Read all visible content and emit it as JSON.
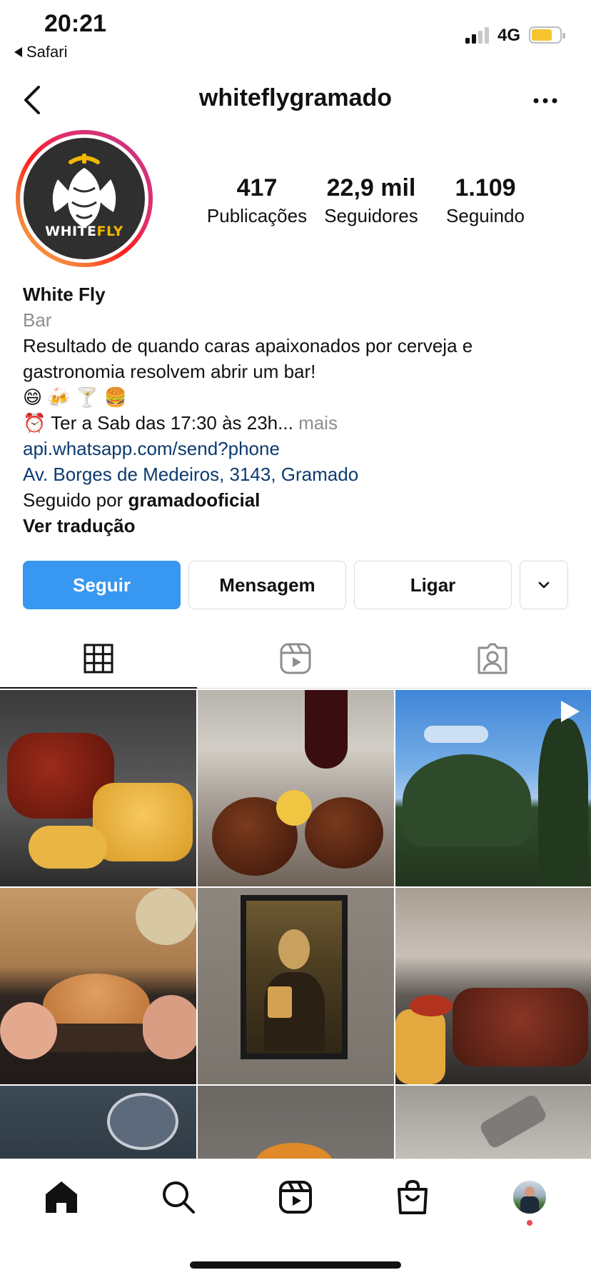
{
  "status_bar": {
    "time": "20:21",
    "back_app": "Safari",
    "network": "4G"
  },
  "header": {
    "username": "whiteflygramado"
  },
  "profile": {
    "avatar_logo_text_a": "WHITE",
    "avatar_logo_text_b": "FLY",
    "stats": [
      {
        "value": "417",
        "label": "Publicações"
      },
      {
        "value": "22,9 mil",
        "label": "Seguidores"
      },
      {
        "value": "1.109",
        "label": "Seguindo"
      }
    ]
  },
  "bio": {
    "name": "White Fly",
    "category": "Bar",
    "description": "Resultado de quando caras apaixonados por cerveja e gastronomia resolvem abrir um bar!",
    "emojis": "😄 🍻 🍸 🍔",
    "hours_emoji": "⏰",
    "hours": "Ter a Sab das 17:30 às 23h...",
    "more_label": "mais",
    "link": "api.whatsapp.com/send?phone",
    "address": "Av. Borges de Medeiros, 3143, Gramado",
    "followed_by_prefix": "Seguido por",
    "followed_by_user": "gramadooficial",
    "translate_label": "Ver tradução"
  },
  "actions": {
    "follow": "Seguir",
    "message": "Mensagem",
    "call": "Ligar"
  },
  "tabs": [
    {
      "icon": "grid-icon",
      "active": true
    },
    {
      "icon": "reels-icon",
      "active": false
    },
    {
      "icon": "tagged-icon",
      "active": false
    }
  ],
  "grid_posts": [
    {
      "subject": "chicken-lollipops-and-fries"
    },
    {
      "subject": "chocolate-dessert-and-wine"
    },
    {
      "subject": "araucaria-trees-sky",
      "video": true
    },
    {
      "subject": "burger-in-hands"
    },
    {
      "subject": "mona-lisa-with-beer-painting"
    },
    {
      "subject": "sliced-brisket"
    },
    {
      "subject": "whitefly-sign"
    },
    {
      "subject": "dim-photo"
    },
    {
      "subject": "key-on-stone"
    }
  ],
  "colors": {
    "primary": "#3897f0",
    "link": "#0c3b70",
    "muted": "#8e8e8e",
    "notification": "#ed4956"
  }
}
